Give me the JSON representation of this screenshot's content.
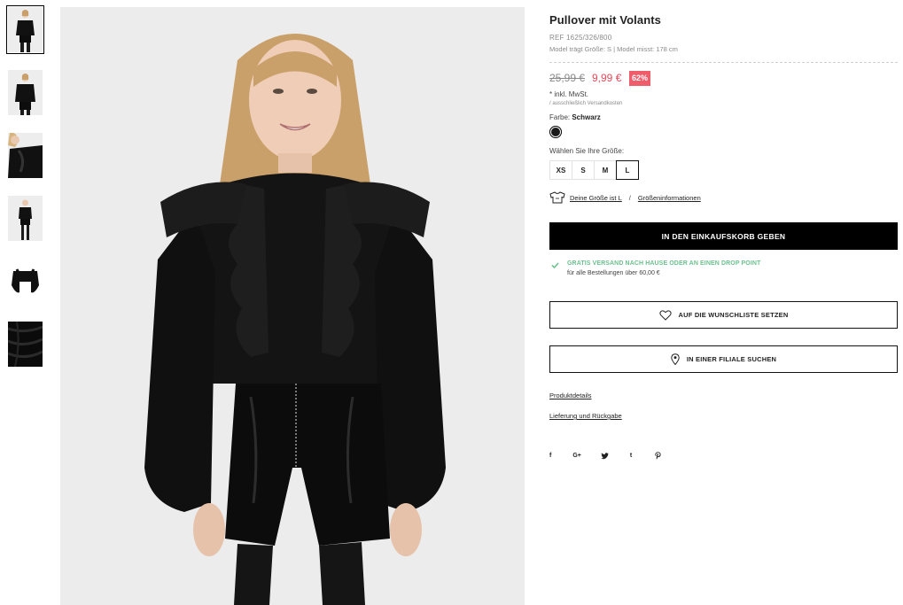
{
  "thumbnails": [
    {
      "name": "thumbnail-1",
      "active": true
    },
    {
      "name": "thumbnail-2",
      "active": false
    },
    {
      "name": "thumbnail-3",
      "active": false
    },
    {
      "name": "thumbnail-4",
      "active": false
    },
    {
      "name": "thumbnail-5",
      "active": false
    },
    {
      "name": "thumbnail-6",
      "active": false
    }
  ],
  "product": {
    "title": "Pullover mit Volants",
    "ref": "REF 1625/326/800",
    "model_info": "Model trägt Größe: S | Model misst: 178 cm",
    "old_price": "25,99 €",
    "new_price": "9,99 €",
    "discount": "62%",
    "vat": "* inkl. MwSt.",
    "shipping_note": "/ ausschließlich Versandkosten",
    "color_prefix": "Farbe: ",
    "color_name": "Schwarz",
    "size_label": "Wählen Sie Ihre Größe:",
    "sizes": [
      "XS",
      "S",
      "M",
      "L"
    ],
    "selected_size": "L",
    "your_size_link": "Deine Größe ist L",
    "fit_separator": "/",
    "size_info_link": "Größeninformationen",
    "add_to_cart": "IN DEN EINKAUFSKORB GEBEN",
    "free_shipping_title": "GRATIS VERSAND NACH HAUSE ODER AN EINEN DROP POINT",
    "free_shipping_sub": "für alle Bestellungen über 60,00 €",
    "wishlist": "AUF DIE WUNSCHLISTE SETZEN",
    "find_store": "IN EINER FILIALE SUCHEN",
    "product_details": "Produktdetails",
    "delivery_returns": "Lieferung und Rückgabe"
  },
  "social": [
    "f",
    "G+",
    "twitter-icon",
    "t",
    "pinterest-icon"
  ],
  "colors": {
    "accent_sale": "#e8495a",
    "discount_bg": "#ef5d6b",
    "free_shipping": "#6dc18f",
    "primary_button": "#000000"
  }
}
